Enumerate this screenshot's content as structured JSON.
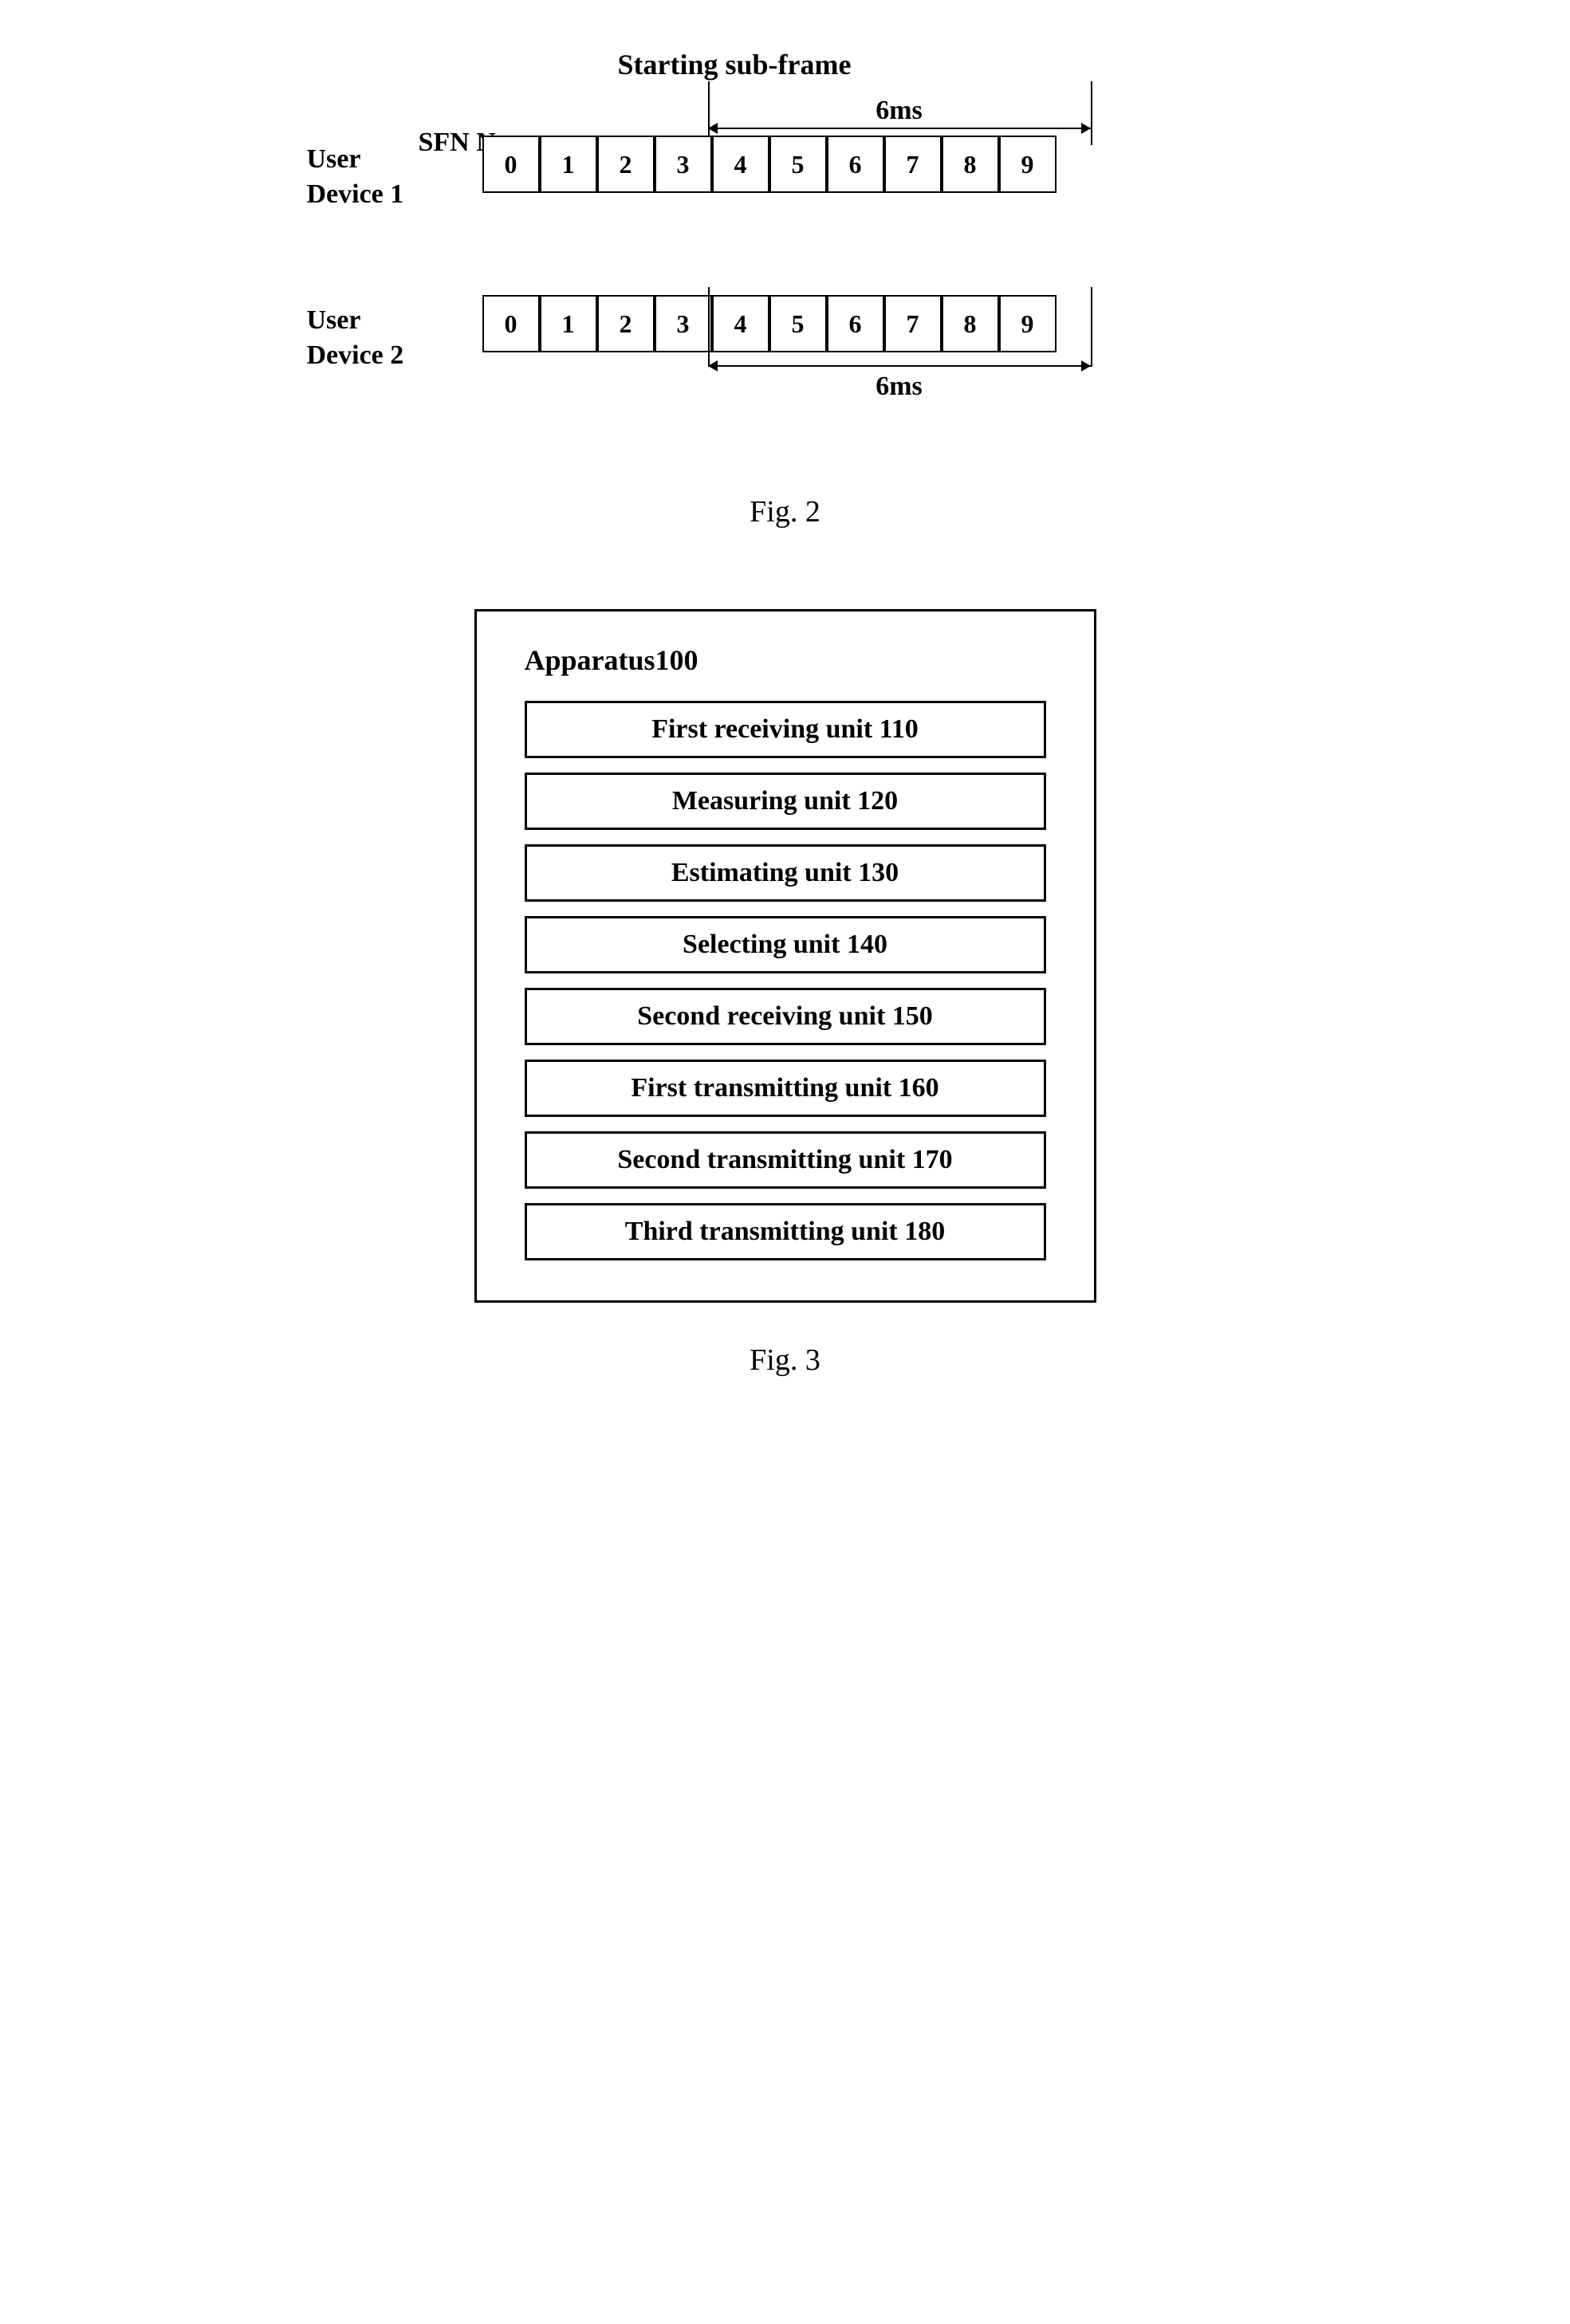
{
  "fig2": {
    "caption": "Fig. 2",
    "starting_label": "Starting sub-frame",
    "sfn_label": "SFN N",
    "ms_label_top": "6ms",
    "ms_label_bottom": "6ms",
    "device1": {
      "label_line1": "User",
      "label_line2": "Device 1"
    },
    "device2": {
      "label_line1": "User",
      "label_line2": "Device 2"
    },
    "cells": [
      "0",
      "1",
      "2",
      "3",
      "4",
      "5",
      "6",
      "7",
      "8",
      "9"
    ]
  },
  "fig3": {
    "caption": "Fig. 3",
    "apparatus_title": "Apparatus100",
    "units": [
      {
        "id": "unit-110",
        "label": "First receiving unit 110"
      },
      {
        "id": "unit-120",
        "label": "Measuring unit 120"
      },
      {
        "id": "unit-130",
        "label": "Estimating unit 130"
      },
      {
        "id": "unit-140",
        "label": "Selecting unit 140"
      },
      {
        "id": "unit-150",
        "label": "Second receiving unit 150"
      },
      {
        "id": "unit-160",
        "label": "First transmitting unit 160"
      },
      {
        "id": "unit-170",
        "label": "Second transmitting unit 170"
      },
      {
        "id": "unit-180",
        "label": "Third transmitting unit 180"
      }
    ]
  }
}
